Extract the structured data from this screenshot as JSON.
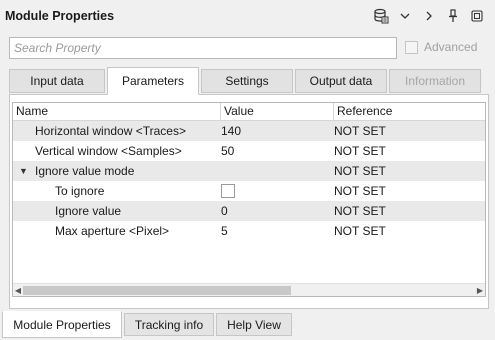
{
  "window": {
    "title": "Module Properties",
    "icons": [
      "database-icon",
      "chevron-down-icon",
      "chevron-right-icon",
      "pin-icon",
      "restore-icon"
    ]
  },
  "search": {
    "placeholder": "Search Property",
    "value": ""
  },
  "advanced": {
    "label": "Advanced",
    "checked": false,
    "enabled": false
  },
  "tabs": [
    {
      "label": "Input data",
      "active": false,
      "enabled": true
    },
    {
      "label": "Parameters",
      "active": true,
      "enabled": true
    },
    {
      "label": "Settings",
      "active": false,
      "enabled": true
    },
    {
      "label": "Output data",
      "active": false,
      "enabled": true
    },
    {
      "label": "Information",
      "active": false,
      "enabled": false
    }
  ],
  "grid": {
    "columns": [
      "Name",
      "Value",
      "Reference"
    ],
    "rows": [
      {
        "name": "Horizontal window <Traces>",
        "value": "140",
        "reference": "NOT SET"
      },
      {
        "name": "Vertical window <Samples>",
        "value": "50",
        "reference": "NOT SET"
      },
      {
        "name": "Ignore value mode",
        "value": "",
        "reference": "NOT SET",
        "expanded": true
      },
      {
        "name": "To ignore",
        "value": "",
        "reference": "NOT SET",
        "checkbox": false
      },
      {
        "name": "Ignore value",
        "value": "0",
        "reference": "NOT SET"
      },
      {
        "name": "Max aperture <Pixel>",
        "value": "5",
        "reference": "NOT SET"
      }
    ]
  },
  "bottom_tabs": [
    {
      "label": "Module Properties",
      "active": true
    },
    {
      "label": "Tracking info",
      "active": false
    },
    {
      "label": "Help View",
      "active": false
    }
  ]
}
